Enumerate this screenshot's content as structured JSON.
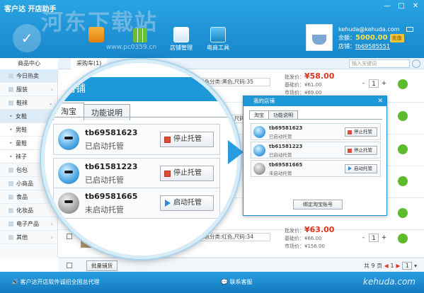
{
  "app": {
    "title": "客户达 开店助手",
    "watermark": "河东下载站",
    "watermark_url": "www.pc0359.cn",
    "window_buttons": [
      "—",
      "□",
      "✕"
    ]
  },
  "toolbar": {
    "store_label": "店铺管理",
    "ecom_label": "电商工具"
  },
  "user": {
    "email": "kehuda@kehuda.com",
    "balance_label": "余额：",
    "balance": "5000.00",
    "recharge_label": "充值",
    "shop_label": "店铺：",
    "shop": "tb69585551"
  },
  "tabs": {
    "left": "商品中心",
    "cart": "采购车(1)"
  },
  "search": {
    "placeholder": "输入关键词"
  },
  "sidebar": {
    "items": [
      {
        "label": "今日热卖",
        "type": "top"
      },
      {
        "label": "服装",
        "type": "top"
      },
      {
        "label": "鞋袜",
        "type": "top"
      },
      {
        "label": "女鞋",
        "type": "sub"
      },
      {
        "label": "男鞋",
        "type": "sub"
      },
      {
        "label": "童鞋",
        "type": "sub"
      },
      {
        "label": "袜子",
        "type": "sub"
      },
      {
        "label": "包包",
        "type": "top"
      },
      {
        "label": "小商品",
        "type": "top"
      },
      {
        "label": "食品",
        "type": "top"
      },
      {
        "label": "化妆品",
        "type": "top"
      },
      {
        "label": "电子产品",
        "type": "top"
      },
      {
        "label": "其他",
        "type": "top"
      }
    ]
  },
  "products": [
    {
      "attr": "颜色分类:黑色,尺码:35",
      "wholesale_label": "批发价：",
      "price": "¥58.00",
      "base": "基础价：¥61.00",
      "market": "市场价：¥69.00",
      "qty": "1"
    },
    {
      "attr": "颜色分类:红色,尺码:35",
      "wholesale_label": "",
      "price": "",
      "base": "",
      "market": "",
      "qty": "1"
    },
    {
      "attr": "颜色分类:红色,尺码:34",
      "wholesale_label": "批发价：",
      "price": "¥63.00",
      "base": "基础价：¥66.00",
      "market": "市场价：¥156.00",
      "qty": "1"
    }
  ],
  "qty_controls": {
    "minus": "-",
    "plus": "+"
  },
  "magnifier": {
    "title": "店铺",
    "tabs": [
      "淘宝",
      "功能说明"
    ],
    "shops": [
      {
        "name": "tb69581623",
        "status": "已启动托管",
        "button": "停止托管",
        "active": true
      },
      {
        "name": "tb61581223",
        "status": "已启动托管",
        "button": "停止托管",
        "active": true
      },
      {
        "name": "tb69581665",
        "status": "未启动托管",
        "button": "启动托管",
        "active": false
      }
    ]
  },
  "dialog": {
    "title": "我的店铺",
    "close": "✕",
    "tabs": [
      "淘宝",
      "功能说明"
    ],
    "shops": [
      {
        "name": "tb69581623",
        "status": "已启动托管",
        "button": "停止托管",
        "active": true
      },
      {
        "name": "tb61581223",
        "status": "已启动托管",
        "button": "停止托管",
        "active": true
      },
      {
        "name": "tb69581665",
        "status": "未启动托管",
        "button": "启动托管",
        "active": false
      }
    ],
    "bind_button": "绑定淘宝账号"
  },
  "batch": {
    "button": "批量铺货"
  },
  "pager": {
    "prefix": "共",
    "total": "9",
    "suffix": "页",
    "current": "1"
  },
  "status": {
    "left": "客户达开店软件诚招全国总代理",
    "mid": "联系客服",
    "right": "kehuda.com"
  },
  "colors": {
    "accent": "#1d98d8",
    "price": "#e0321c",
    "cart": "#5dbb2d"
  }
}
